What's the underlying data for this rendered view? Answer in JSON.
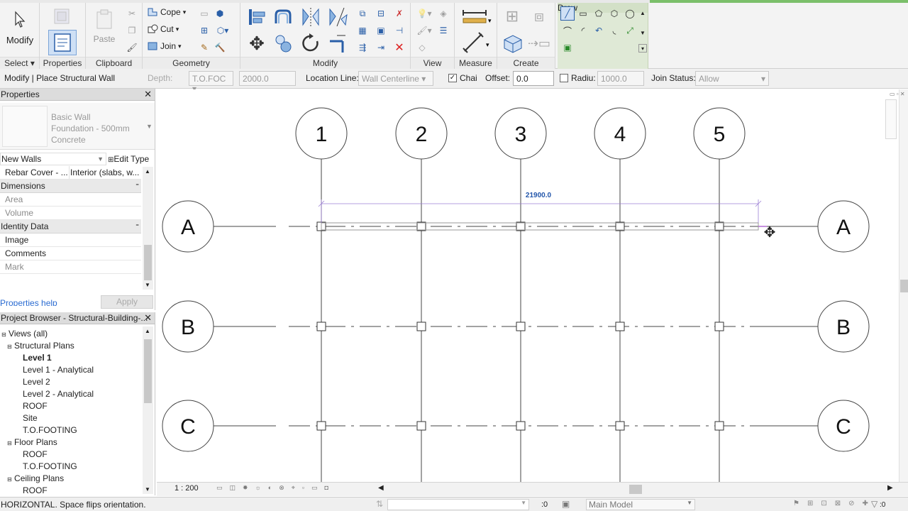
{
  "ribbon": {
    "select": {
      "label": "Modify",
      "panel": "Select"
    },
    "properties": {
      "panel": "Properties"
    },
    "clipboard": {
      "paste": "Paste",
      "panel": "Clipboard"
    },
    "geometry": {
      "cope": "Cope",
      "cut": "Cut",
      "join": "Join",
      "panel": "Geometry"
    },
    "modify": {
      "panel": "Modify"
    },
    "view": {
      "panel": "View"
    },
    "measure": {
      "panel": "Measure"
    },
    "create": {
      "panel": "Create"
    },
    "draw": {
      "panel": "Draw"
    }
  },
  "options": {
    "context": "Modify | Place Structural Wall",
    "depth_label": "Depth:",
    "depth_value": "T.O.FOC",
    "depth_amount": "2000.0",
    "location_label": "Location Line:",
    "location_value": "Wall Centerline",
    "chain_label": "Chai",
    "offset_label": "Offset:",
    "offset_value": "0.0",
    "radius_label": "Radiu:",
    "radius_value": "1000.0",
    "join_label": "Join Status:",
    "join_value": "Allow"
  },
  "properties": {
    "title": "Properties",
    "type_line1": "Basic Wall",
    "type_line2": "Foundation - 500mm",
    "type_line3": "Concrete",
    "selector": "New Walls",
    "edit_type": "Edit Type",
    "rows": [
      {
        "k": "Rebar Cover - ...",
        "v": "Interior (slabs, w..."
      }
    ],
    "group_dimensions": "Dimensions",
    "area": "Area",
    "volume": "Volume",
    "group_identity": "Identity Data",
    "image": "Image",
    "comments": "Comments",
    "mark": "Mark",
    "help": "Properties help",
    "apply": "Apply"
  },
  "browser": {
    "title": "Project Browser - Structural-Building-...",
    "views_all": "Views (all)",
    "structural_plans": "Structural Plans",
    "level1": "Level 1",
    "level1a": "Level 1 - Analytical",
    "level2": "Level 2",
    "level2a": "Level 2 - Analytical",
    "roof": "ROOF",
    "site": "Site",
    "tofooting": "T.O.FOOTING",
    "floor_plans": "Floor Plans",
    "fp_roof": "ROOF",
    "fp_tofooting": "T.O.FOOTING",
    "ceiling_plans": "Ceiling Plans",
    "cp_roof": "ROOF"
  },
  "view": {
    "grid_numbers": [
      "1",
      "2",
      "3",
      "4",
      "5"
    ],
    "grid_letters": [
      "A",
      "B",
      "C"
    ],
    "dimension": "21900.0",
    "scale": "1 : 200"
  },
  "status": {
    "message": "HORIZONTAL. Space flips orientation.",
    "zero": ":0",
    "model": "Main Model",
    "filter_count": ":0"
  },
  "colors": {
    "accent_blue": "#2255aa",
    "draw_panel": "#dfe9d6",
    "dim_purple": "#9b7fd4"
  }
}
